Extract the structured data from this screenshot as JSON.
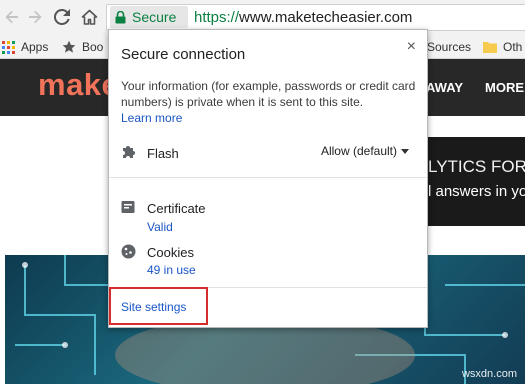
{
  "toolbar": {
    "secure_label": "Secure",
    "url_scheme": "https://",
    "url_host": "www.maketecheasier.com"
  },
  "bookmarks": {
    "apps_label": "Apps",
    "boo_label": "Boo",
    "sources_label": "Sources",
    "oth_label": "Oth"
  },
  "site": {
    "logo_text": "make",
    "nav_away": "AWAY",
    "nav_more": "MORE",
    "ad_line1": "LYTICS FOR",
    "ad_line2": "l answers in yo",
    "watermark": "wsxdn.com"
  },
  "popup": {
    "title": "Secure connection",
    "close_glyph": "×",
    "description": "Your information (for example, passwords or credit card numbers) is private when it is sent to this site.",
    "learn_more": "Learn more",
    "flash_label": "Flash",
    "flash_value": "Allow (default)",
    "certificate_label": "Certificate",
    "certificate_status": "Valid",
    "cookies_label": "Cookies",
    "cookies_count": "49 in use",
    "site_settings": "Site settings"
  },
  "colors": {
    "secure_green": "#0b8043",
    "link_blue": "#1a56c6",
    "highlight_red": "#d62c2c",
    "logo_orange": "#f0735a"
  }
}
